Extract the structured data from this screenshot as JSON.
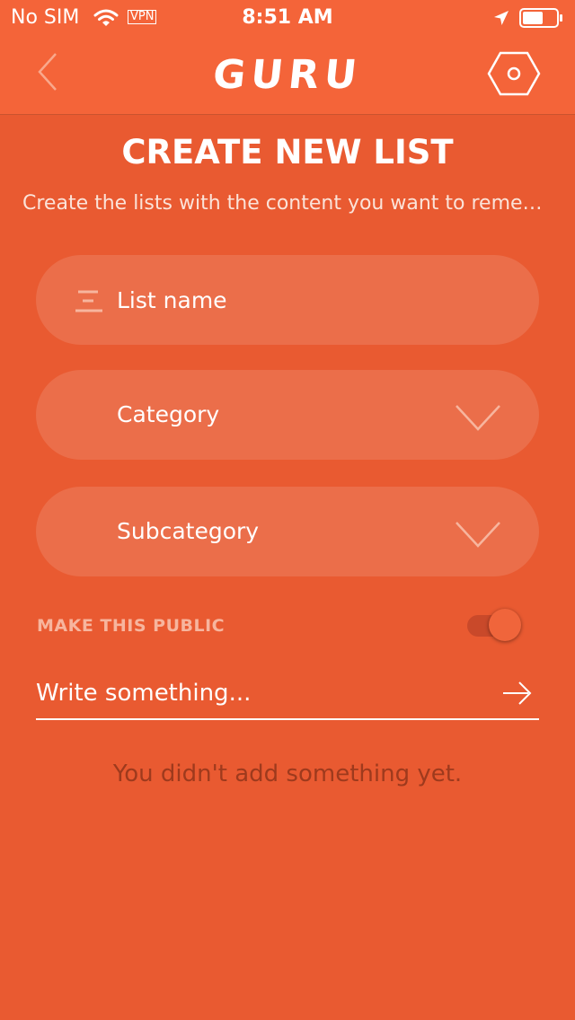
{
  "status_bar": {
    "carrier": "No SIM",
    "vpn": "VPN",
    "time": "8:51 AM"
  },
  "header": {
    "brand": "GURU",
    "back_icon": "chevron-left-icon",
    "settings_icon": "hexagon-settings-icon"
  },
  "page": {
    "title": "CREATE NEW LIST",
    "subtitle": "Create the lists with the content you want to remember"
  },
  "form": {
    "list_name": {
      "placeholder": "List name",
      "value": "",
      "icon": "text-lines-icon"
    },
    "category": {
      "label": "Category",
      "icon": "chevron-down-icon"
    },
    "subcategory": {
      "label": "Subcategory",
      "icon": "chevron-down-icon"
    },
    "make_public": {
      "label": "MAKE THIS PUBLIC",
      "enabled": true
    },
    "write": {
      "placeholder": "Write something...",
      "value": "",
      "icon": "arrow-right-icon"
    }
  },
  "empty_state": {
    "message": "You didn't add something yet."
  },
  "colors": {
    "background": "#E95A31",
    "header": "#F46439",
    "field": "rgba(255,255,255,0.12)",
    "empty_text": "#9E3A1D",
    "public_label": "#F7B59E"
  }
}
